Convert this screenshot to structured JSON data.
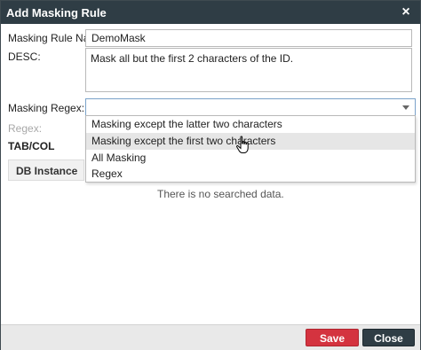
{
  "dialog": {
    "title": "Add Masking Rule",
    "close_glyph": "×"
  },
  "form": {
    "rule_name_label": "Masking Rule Na...",
    "rule_name_value": "DemoMask",
    "desc_label": "DESC:",
    "desc_value": "Mask all but the first 2 characters of the ID.",
    "regex_select_label": "Masking Regex:",
    "regex_select_value": "",
    "regex_label": "Regex:"
  },
  "dropdown": {
    "options": [
      "Masking except the latter two characters",
      "Masking except the first two characters",
      "All Masking",
      "Regex"
    ],
    "hovered_index": 1
  },
  "tabcol": {
    "title": "TAB/COL",
    "column_header": "DB Instance",
    "empty_message": "There is no searched data."
  },
  "footer": {
    "save_label": "Save",
    "close_label": "Close"
  },
  "colors": {
    "titlebar": "#2f3d45",
    "save": "#d4333f",
    "close": "#2f3d45"
  },
  "icons": {
    "cursor": "hand-pointer-icon",
    "dropdown": "chevron-down-icon",
    "close": "close-icon"
  }
}
